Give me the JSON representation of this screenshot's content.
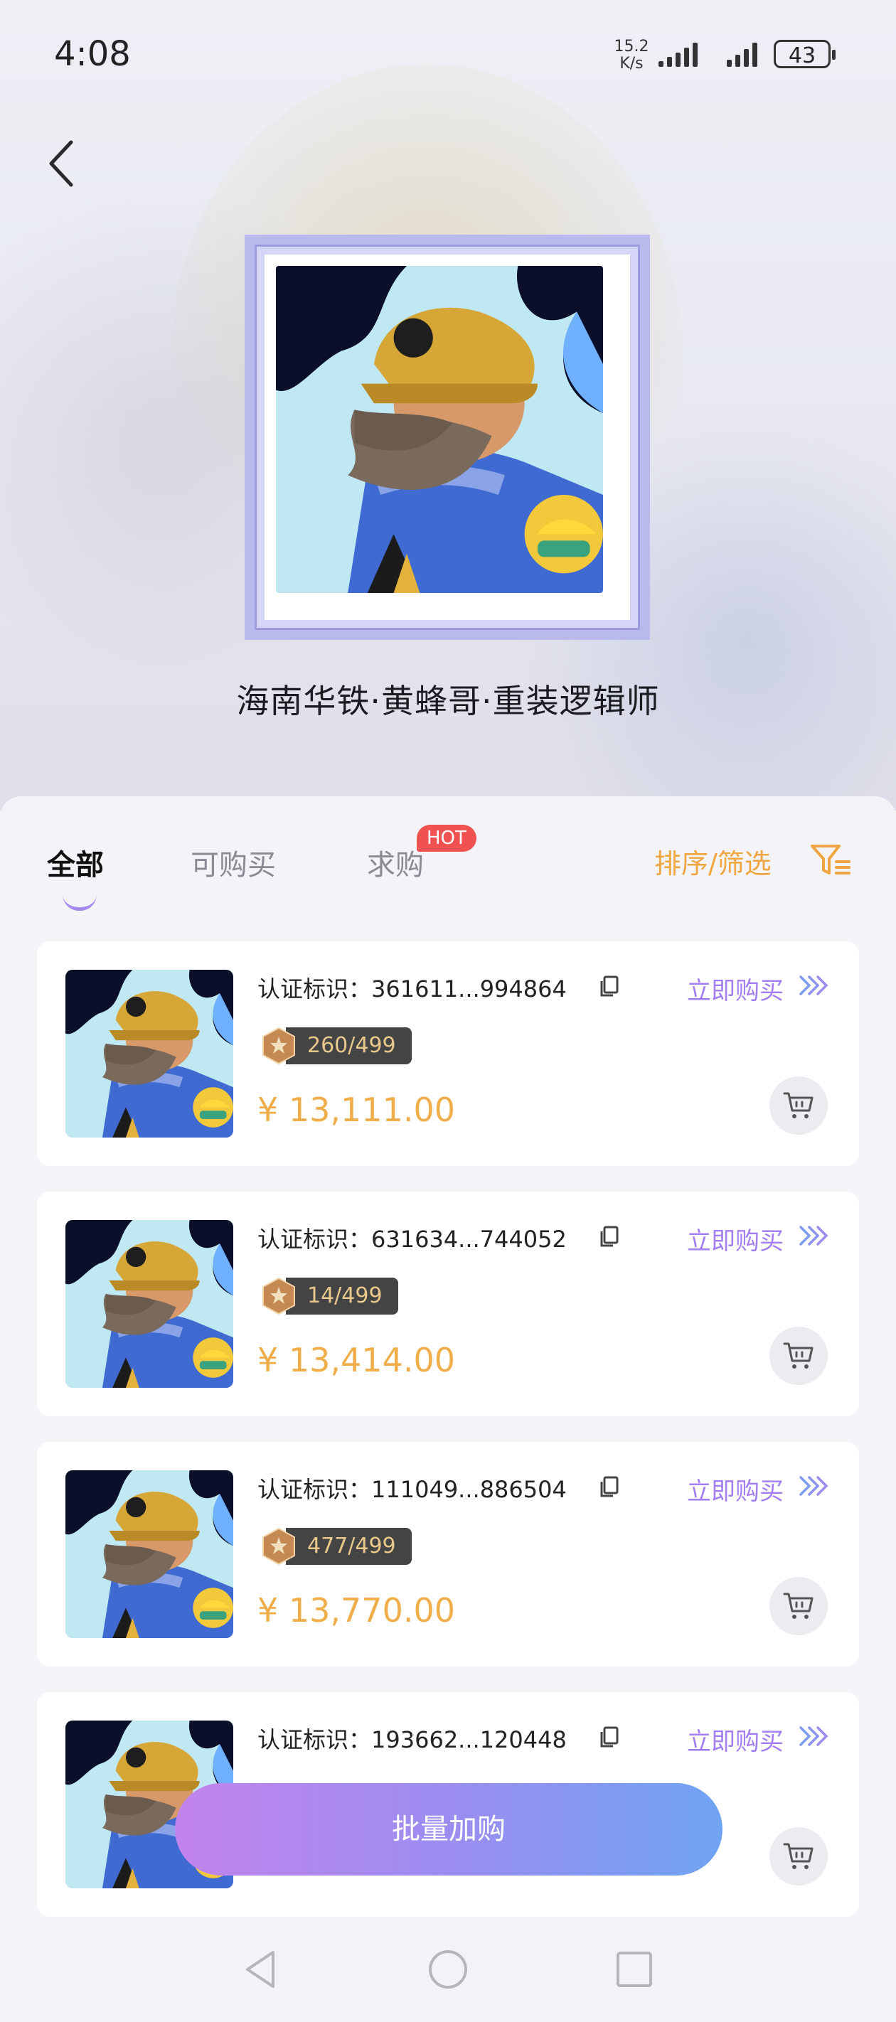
{
  "status_bar": {
    "time": "4:08",
    "net_speed_value": "15.2",
    "net_speed_unit": "K/s",
    "battery": "43"
  },
  "collection": {
    "title": "海南华铁·黄蜂哥·重装逻辑师"
  },
  "tabs": [
    {
      "label": "全部",
      "active": true
    },
    {
      "label": "可购买",
      "active": false
    },
    {
      "label": "求购",
      "active": false,
      "badge": "HOT"
    }
  ],
  "sort_filter_label": "排序/筛选",
  "cert_label": "认证标识：",
  "buy_now_label": "立即购买",
  "listings": [
    {
      "cert_id": "361611...994864",
      "edition": "260/499",
      "price": "¥ 13,111.00"
    },
    {
      "cert_id": "631634...744052",
      "edition": "14/499",
      "price": "¥ 13,414.00"
    },
    {
      "cert_id": "111049...886504",
      "edition": "477/499",
      "price": "¥ 13,770.00"
    },
    {
      "cert_id": "193662...120448",
      "edition": "",
      "price": ""
    }
  ],
  "bulk_button_label": "批量加购",
  "colors": {
    "accent_purple": "#a27ef0",
    "price_orange": "#f0ae4a",
    "sort_orange": "#f0a640",
    "hot_red": "#f05252"
  },
  "icons": [
    "back-arrow-icon",
    "copy-icon",
    "double-chevron-icon",
    "star-hexagon-icon",
    "cart-icon",
    "filter-icon",
    "nav-back-icon",
    "nav-home-icon",
    "nav-recents-icon"
  ]
}
